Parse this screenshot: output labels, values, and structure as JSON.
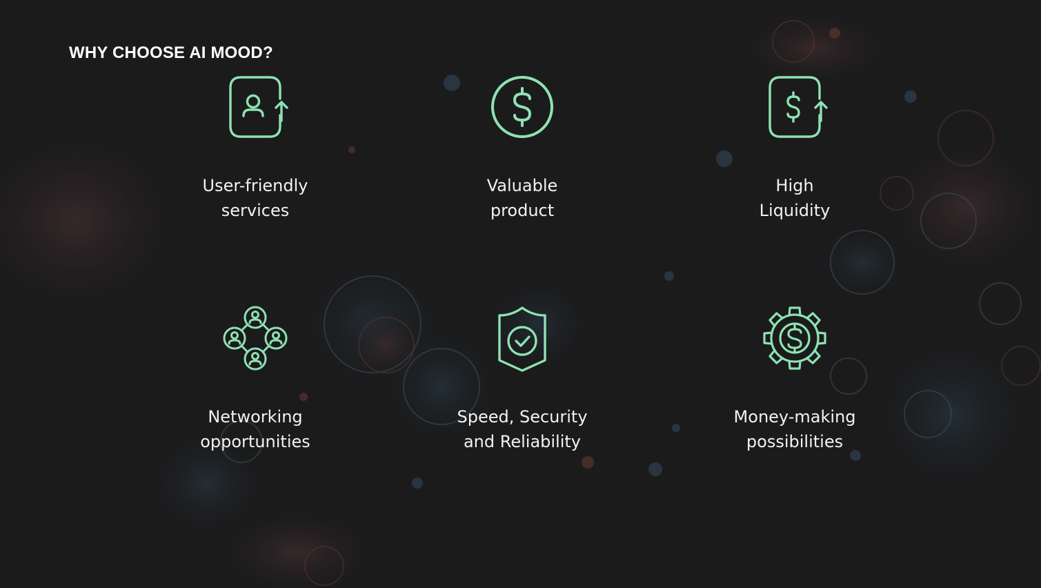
{
  "page": {
    "title": "WHY CHOOSE AI MOOD?"
  },
  "colors": {
    "accent": "#8ee2b2",
    "text": "#f2f2f2",
    "background": "#1b1b1c"
  },
  "features": [
    {
      "icon": "user-upload-icon",
      "line1": "User-friendly",
      "line2": "services"
    },
    {
      "icon": "dollar-circle-icon",
      "line1": "Valuable",
      "line2": "product"
    },
    {
      "icon": "dollar-upload-icon",
      "line1": "High",
      "line2": "Liquidity"
    },
    {
      "icon": "network-users-icon",
      "line1": "Networking",
      "line2": "opportunities"
    },
    {
      "icon": "shield-check-icon",
      "line1": "Speed, Security",
      "line2": "and Reliability"
    },
    {
      "icon": "gear-dollar-icon",
      "line1": "Money-making",
      "line2": "possibilities"
    }
  ]
}
